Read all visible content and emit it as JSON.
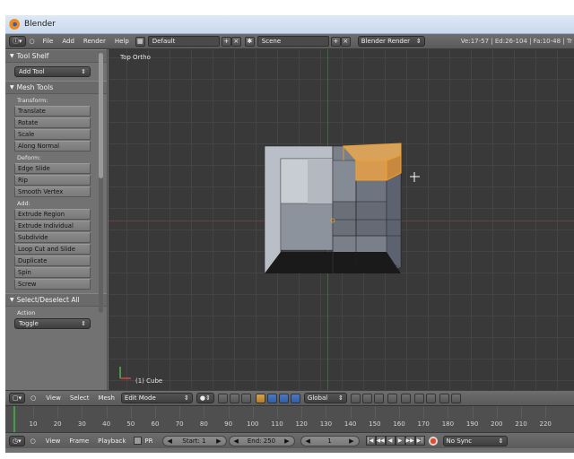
{
  "window": {
    "title": "Blender"
  },
  "info_header": {
    "menus": [
      "File",
      "Add",
      "Render",
      "Help"
    ],
    "layout_name": "Default",
    "scene_name": "Scene",
    "render_engine": "Blender Render",
    "stats": "Ve:17-57 | Ed:26-104 | Fa:10-48 | Tr"
  },
  "tool_shelf": {
    "title": "Tool Shelf",
    "add_tool_label": "Add Tool",
    "mesh_tools_title": "Mesh Tools",
    "sections": [
      {
        "label": "Transform:",
        "buttons": [
          "Translate",
          "Rotate",
          "Scale",
          "Along Normal"
        ]
      },
      {
        "label": "Deform:",
        "buttons": [
          "Edge Slide",
          "Rip",
          "Smooth Vertex"
        ]
      },
      {
        "label": "Add:",
        "buttons": [
          "Extrude Region",
          "Extrude Individual",
          "Subdivide",
          "Loop Cut and Slide",
          "Duplicate",
          "Spin",
          "Screw"
        ]
      }
    ],
    "select_panel_title": "Select/Deselect All",
    "action_label": "Action",
    "action_value": "Toggle"
  },
  "viewport": {
    "view_label": "Top Ortho",
    "object_label": "(1) Cube"
  },
  "view3d_header": {
    "menus": [
      "View",
      "Select",
      "Mesh"
    ],
    "mode": "Edit Mode",
    "orientation": "Global"
  },
  "timeline": {
    "ticks": [
      "10",
      "20",
      "30",
      "40",
      "50",
      "60",
      "70",
      "80",
      "90",
      "100",
      "110",
      "120",
      "130",
      "140",
      "150",
      "160",
      "170",
      "180",
      "190",
      "200",
      "210",
      "220"
    ]
  },
  "bottom_header": {
    "menus": [
      "View",
      "Frame",
      "Playback"
    ],
    "pr_label": "PR",
    "start_label": "Start: 1",
    "end_label": "End: 250",
    "current_frame": "1",
    "sync_mode": "No Sync"
  },
  "colors": {
    "selection_orange": "#f0a030",
    "background_grey": "#393939",
    "header_grey": "#646464"
  }
}
